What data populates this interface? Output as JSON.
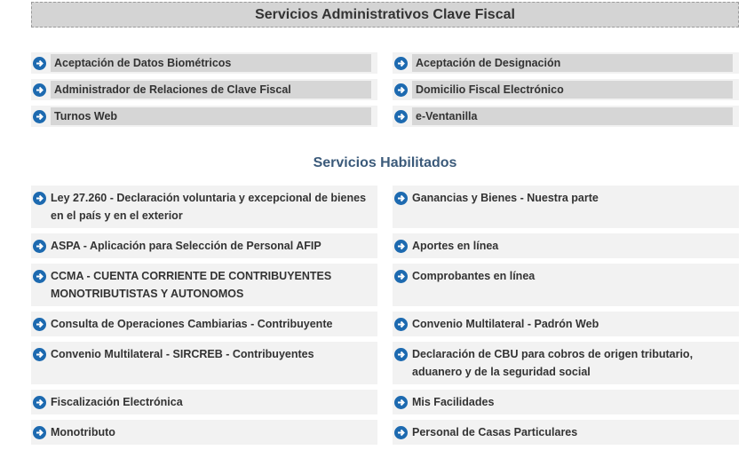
{
  "header": {
    "title": "Servicios Administrativos Clave Fiscal"
  },
  "admin": {
    "rows": [
      [
        "Aceptación de Datos Biométricos",
        "Aceptación de Designación"
      ],
      [
        "Administrador de Relaciones de Clave Fiscal",
        "Domicilio Fiscal Electrónico"
      ],
      [
        "Turnos Web",
        "e-Ventanilla"
      ]
    ]
  },
  "habilitados": {
    "title": "Servicios Habilitados",
    "rows": [
      [
        "Ley 27.260 - Declaración voluntaria y excepcional de bienes en el país y en el exterior",
        "Ganancias y Bienes - Nuestra parte"
      ],
      [
        "ASPA - Aplicación para Selección de Personal AFIP",
        "Aportes en línea"
      ],
      [
        "CCMA - CUENTA CORRIENTE DE CONTRIBUYENTES MONOTRIBUTISTAS Y AUTONOMOS",
        "Comprobantes en línea"
      ],
      [
        "Consulta de Operaciones Cambiarias - Contribuyente",
        "Convenio Multilateral - Padrón Web"
      ],
      [
        "Convenio Multilateral - SIRCREB - Contribuyentes",
        "Declaración de CBU para cobros de origen tributario, aduanero y de la seguridad social"
      ],
      [
        "Fiscalización Electrónica",
        "Mis Facilidades"
      ],
      [
        "Monotributo",
        "Personal de Casas Particulares"
      ]
    ]
  },
  "icons": {
    "item_icon": "arrow-right-circle-icon"
  },
  "colors": {
    "accent": "#1d6ab0",
    "header_bg": "#d4d4d4",
    "item_bg": "#f2f2f2",
    "section_title": "#3b5a7a"
  }
}
